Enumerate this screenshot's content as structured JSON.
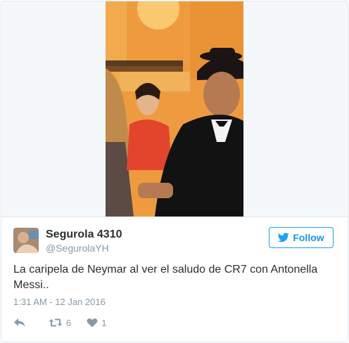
{
  "tweet": {
    "display_name": "Segurola 4310",
    "handle": "@SegurolaYH",
    "follow_label": "Follow",
    "text_line1": "La caripela de Neymar al ver el saludo de CR7 con Antonella",
    "text_line2": "Messi..",
    "timestamp": "1:31 AM - 12 Jan 2016",
    "actions": {
      "reply_icon": "reply-icon",
      "retweet_icon": "retweet-icon",
      "retweet_count": "6",
      "like_icon": "heart-icon",
      "like_count": "1"
    }
  },
  "colors": {
    "accent": "#1da1f2",
    "text": "#292f33",
    "muted": "#8899a6",
    "border": "#e1e8ed"
  }
}
